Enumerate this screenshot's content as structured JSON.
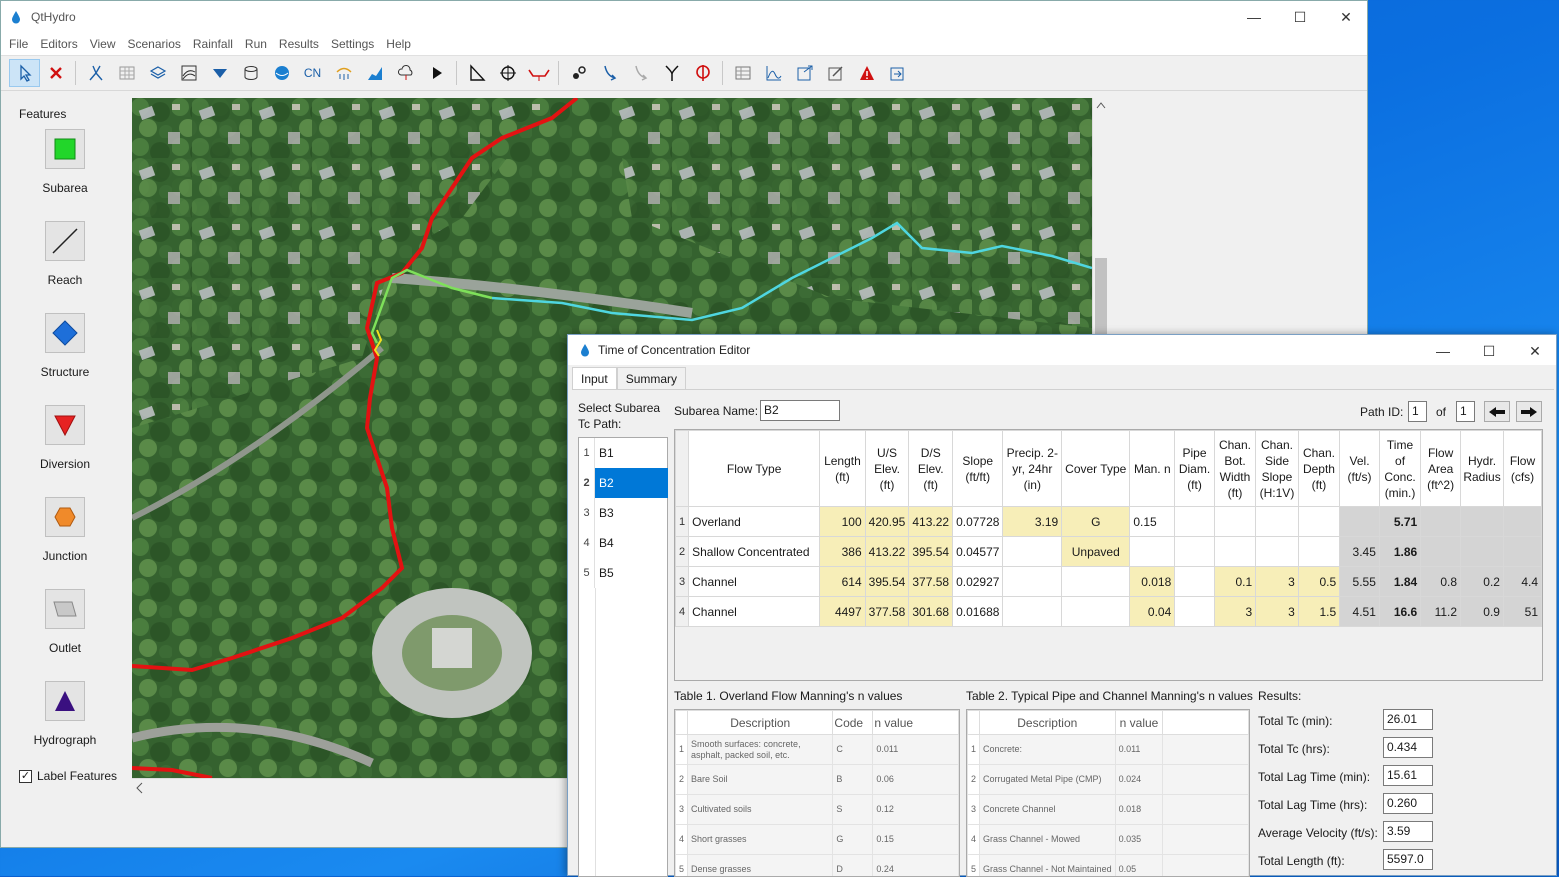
{
  "app": {
    "title": "QtHydro",
    "menu": [
      "File",
      "Editors",
      "View",
      "Scenarios",
      "Rainfall",
      "Run",
      "Results",
      "Settings",
      "Help"
    ],
    "toolbar_icons": [
      "select-arrow-icon",
      "delete-x-icon",
      "network-icon",
      "grid-icon",
      "layers-icon",
      "terrain-icon",
      "channel-icon",
      "storage-icon",
      "globe-icon",
      "cn-icon",
      "rainfall-icon",
      "hydrograph-chart-icon",
      "cloud-icon",
      "run-play-icon",
      "measure-icon",
      "target-icon",
      "reach-profile-icon",
      "link-icon",
      "curve-arrow-icon",
      "curve-arrow-gray-icon",
      "junction-y-icon",
      "outlet-pin-icon",
      "table-icon",
      "chart-icon",
      "export-icon",
      "edit-icon",
      "warning-icon",
      "export2-icon"
    ],
    "cn_label": "CN"
  },
  "features": {
    "header": "Features",
    "items": [
      {
        "label": "Subarea",
        "icon": "subarea-square-icon",
        "color": "#22d62a"
      },
      {
        "label": "Reach",
        "icon": "reach-line-icon",
        "color": "#222222"
      },
      {
        "label": "Structure",
        "icon": "structure-diamond-icon",
        "color": "#1e6fd9"
      },
      {
        "label": "Diversion",
        "icon": "diversion-triangle-icon",
        "color": "#e62222"
      },
      {
        "label": "Junction",
        "icon": "junction-hexagon-icon",
        "color": "#f08a2a"
      },
      {
        "label": "Outlet",
        "icon": "outlet-parallelogram-icon",
        "color": "#b8b8b8"
      },
      {
        "label": "Hydrograph",
        "icon": "hydrograph-triangle-icon",
        "color": "#3a1080"
      }
    ],
    "label_features": "Label Features"
  },
  "dialog": {
    "title": "Time of Concentration Editor",
    "tabs": [
      "Input",
      "Summary"
    ],
    "select_label_1": "Select Subarea",
    "select_label_2": "Tc Path:",
    "subarea_name_label": "Subarea Name:",
    "subarea_name": "B2",
    "path_id_label": "Path ID:",
    "path_id": "1",
    "of_label": "of",
    "path_count": "1",
    "subareas": [
      "B1",
      "B2",
      "B3",
      "B4",
      "B5"
    ],
    "grid_headers": [
      "Flow Type",
      "Length (ft)",
      "U/S Elev. (ft)",
      "D/S Elev. (ft)",
      "Slope (ft/ft)",
      "Precip. 2-yr, 24hr (in)",
      "Cover Type",
      "Man. n",
      "Pipe Diam. (ft)",
      "Chan. Bot. Width (ft)",
      "Chan. Side Slope (H:1V)",
      "Chan. Depth (ft)",
      "Vel. (ft/s)",
      "Time of Conc. (min.)",
      "Flow Area (ft^2)",
      "Hydr. Radius",
      "Flow (cfs)"
    ],
    "grid_rows": [
      [
        "Overland",
        "100",
        "420.95",
        "413.22",
        "0.07728",
        "3.19",
        "G",
        "0.15",
        "",
        "",
        "",
        "",
        "",
        "5.71",
        "",
        "",
        ""
      ],
      [
        "Shallow Concentrated",
        "386",
        "413.22",
        "395.54",
        "0.04577",
        "",
        "Unpaved",
        "",
        "",
        "",
        "",
        "",
        "3.45",
        "1.86",
        "",
        "",
        ""
      ],
      [
        "Channel",
        "614",
        "395.54",
        "377.58",
        "0.02927",
        "",
        "",
        "0.018",
        "",
        "0.1",
        "3",
        "0.5",
        "5.55",
        "1.84",
        "0.8",
        "0.2",
        "4.4"
      ],
      [
        "Channel",
        "4497",
        "377.58",
        "301.68",
        "0.01688",
        "",
        "",
        "0.04",
        "",
        "3",
        "3",
        "1.5",
        "4.51",
        "16.6",
        "11.2",
        "0.9",
        "51"
      ]
    ],
    "table1": {
      "title": "Table 1. Overland Flow Manning's n values",
      "headers": [
        "Description",
        "Code",
        "n value"
      ],
      "rows": [
        [
          "Smooth surfaces: concrete, asphalt, packed soil, etc.",
          "C",
          "0.011"
        ],
        [
          "Bare Soil",
          "B",
          "0.06"
        ],
        [
          "Cultivated soils",
          "S",
          "0.12"
        ],
        [
          "Short grasses",
          "G",
          "0.15"
        ],
        [
          "Dense grasses",
          "D",
          "0.24"
        ]
      ]
    },
    "table2": {
      "title": "Table 2. Typical Pipe and Channel Manning's n values",
      "headers": [
        "Description",
        "n value"
      ],
      "rows": [
        [
          "Concrete:",
          "0.011"
        ],
        [
          "Corrugated Metal Pipe (CMP)",
          "0.024"
        ],
        [
          "Concrete Channel",
          "0.018"
        ],
        [
          "Grass Channel - Mowed",
          "0.035"
        ],
        [
          "Grass Channel - Not Maintained",
          "0.05"
        ]
      ]
    },
    "results": {
      "title": "Results:",
      "items": [
        {
          "label": "Total Tc (min):",
          "value": "26.01"
        },
        {
          "label": "Total Tc (hrs):",
          "value": "0.434"
        },
        {
          "label": "Total Lag Time (min):",
          "value": "15.61"
        },
        {
          "label": "Total Lag Time (hrs):",
          "value": "0.260"
        },
        {
          "label": "Average Velocity (ft/s):",
          "value": "3.59"
        },
        {
          "label": "Total Length (ft):",
          "value": "5597.0"
        }
      ]
    }
  }
}
